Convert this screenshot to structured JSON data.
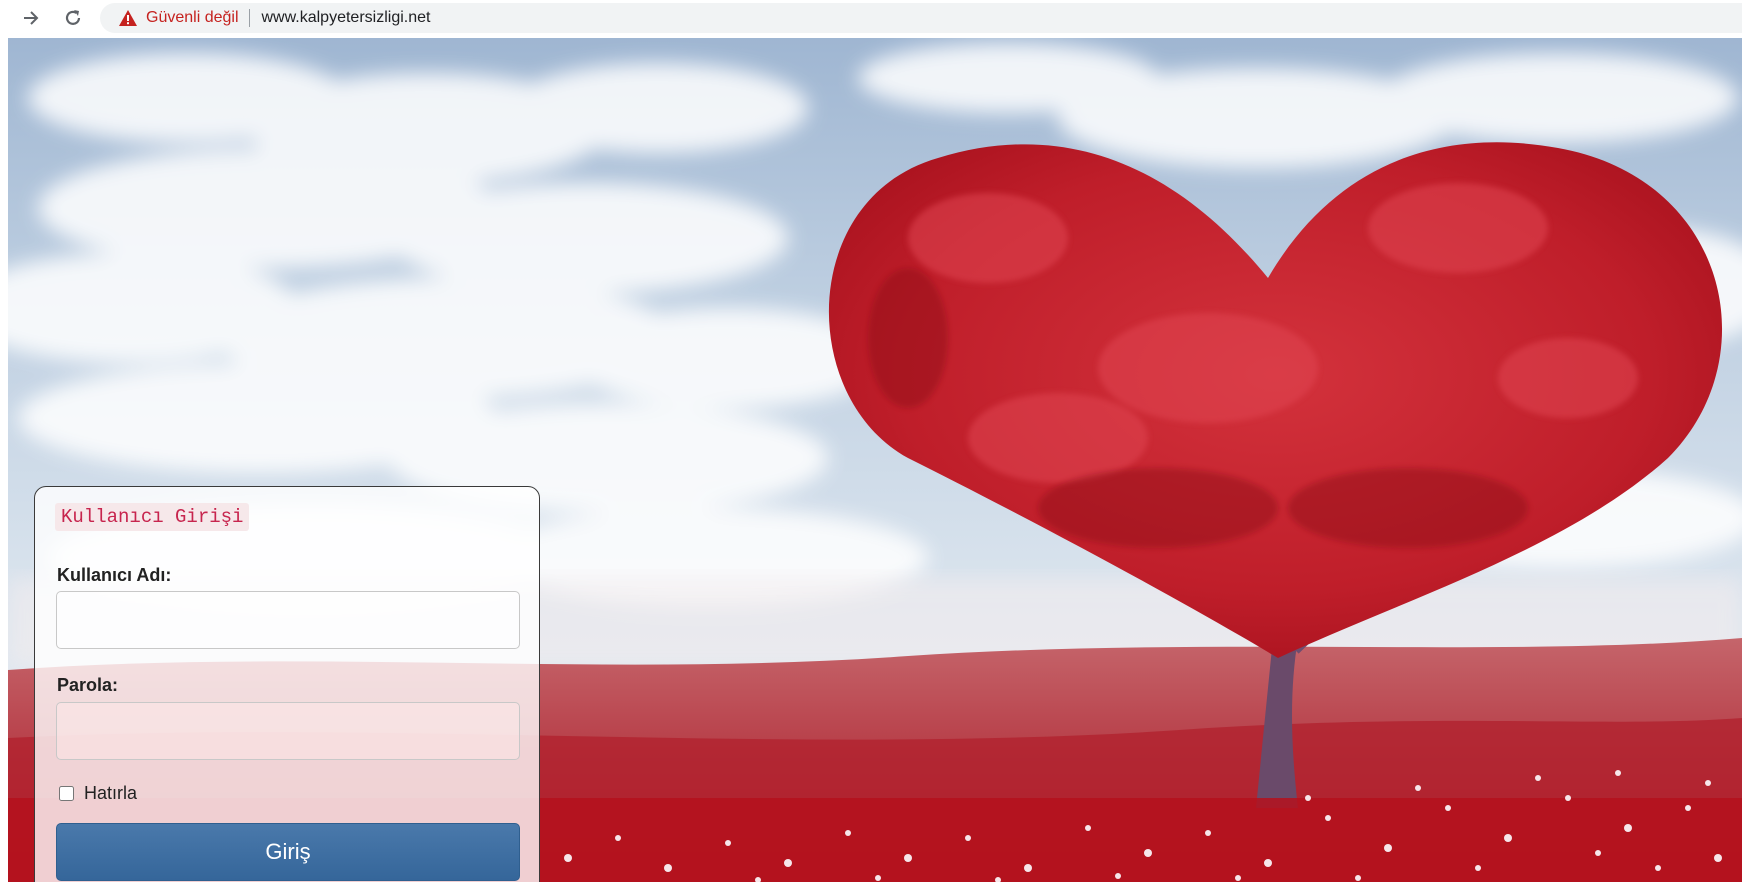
{
  "browser": {
    "security_label": "Güvenli değil",
    "url": "www.kalpyetersizligi.net",
    "icons": [
      "forward-arrow-icon",
      "reload-icon",
      "warning-triangle-icon"
    ]
  },
  "login": {
    "title": "Kullanıcı Girişi",
    "username_label": "Kullanıcı Adı:",
    "username_value": "",
    "password_label": "Parola:",
    "password_value": "",
    "remember_label": "Hatırla",
    "remember_checked": false,
    "submit_label": "Giriş"
  },
  "colors": {
    "security_warning": "#c5221f",
    "title_text": "#c7254e",
    "submit_button": "#3e6fa3"
  }
}
